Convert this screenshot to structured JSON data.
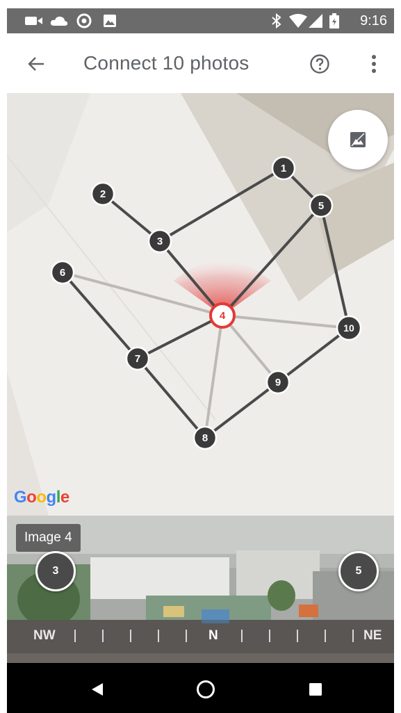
{
  "status_bar": {
    "time": "9:16",
    "icons": [
      "video-camera-icon",
      "cloud-icon",
      "location-target-icon",
      "image-icon",
      "bluetooth-icon",
      "wifi-icon",
      "cell-signal-icon",
      "battery-icon"
    ]
  },
  "app_bar": {
    "title": "Connect 10 photos",
    "back_icon": "arrow-back-icon",
    "help_icon": "help-circle-icon",
    "more_icon": "more-vert-icon"
  },
  "map": {
    "logo_text": "Google",
    "photo_button_icon": "image-icon",
    "selected_node": "4",
    "nodes": [
      "1",
      "2",
      "3",
      "4",
      "5",
      "6",
      "7",
      "8",
      "9",
      "10"
    ]
  },
  "panorama": {
    "image_label": "Image 4",
    "left_node": "3",
    "right_node": "5",
    "compass": {
      "left": "NW",
      "center": "N",
      "right": "NE"
    }
  },
  "colors": {
    "status_bar": "#6b6b6b",
    "title": "#5f6368",
    "map_bg": "#efedea",
    "node_fill": "#3a3a3a",
    "edge_dark": "#4a4a4a",
    "edge_light": "#bdbab6",
    "selected_accent": "#e53935"
  },
  "nav_bar": {
    "icons": [
      "back-triangle-icon",
      "home-circle-icon",
      "recents-square-icon"
    ]
  }
}
